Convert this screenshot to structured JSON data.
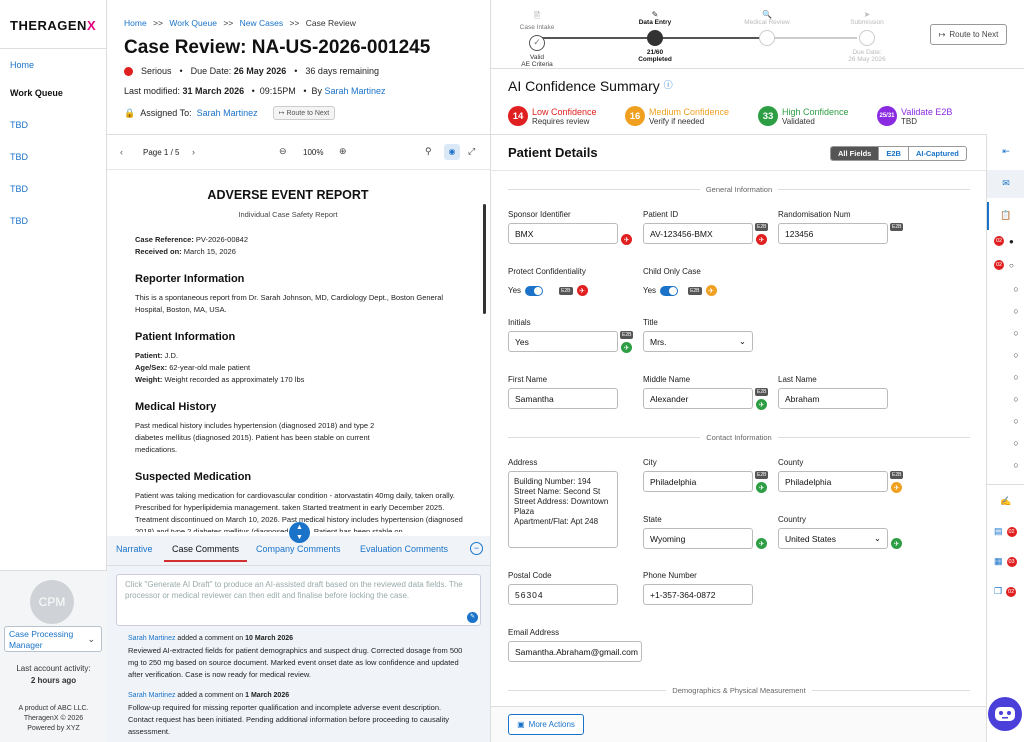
{
  "brand": {
    "name": "THERAGEN",
    "x": "X"
  },
  "sidebar": {
    "items": [
      "Home",
      "Work Queue",
      "TBD",
      "TBD",
      "TBD",
      "TBD"
    ],
    "avatar": "CPM",
    "role": "Case Processing Manager",
    "last_activity_label": "Last account activity:",
    "last_activity": "2 hours ago",
    "footer1": "A product of ABC LLC.",
    "footer2": "TheragenX © 2026",
    "footer3": "Powered by XYZ"
  },
  "breadcrumb": {
    "home": "Home",
    "sep": ">>",
    "queue": "Work Queue",
    "new": "New Cases",
    "current": "Case Review"
  },
  "case": {
    "title": "Case Review: NA-US-2026-001245",
    "severity": "Serious",
    "due_label": "Due Date:",
    "due": "26 May 2026",
    "remaining": "36 days remaining",
    "modified_label": "Last modified:",
    "modified_date": "31 March 2026",
    "modified_time": "09:15PM",
    "by_label": "By",
    "by": "Sarah Martinez",
    "assigned_label": "Assigned To:",
    "assigned": "Sarah Martinez",
    "route_small": "Route to Next"
  },
  "stepper": {
    "steps": [
      {
        "name": "Case Intake",
        "status": "Valid",
        "status2": "AE Criteria"
      },
      {
        "name": "Data Entry",
        "status": "21/60",
        "status2": "Completed"
      },
      {
        "name": "Medical Review",
        "status": "",
        "status2": ""
      },
      {
        "name": "Submission",
        "status": "Due Date:",
        "status2": "26 May 2026"
      }
    ],
    "route": "Route to Next"
  },
  "ai": {
    "title": "AI Confidence Summary",
    "items": [
      {
        "count": "14",
        "label": "Low Confidence",
        "sub": "Requires review",
        "color": "#e02020"
      },
      {
        "count": "16",
        "label": "Medium Confidence",
        "sub": "Verify if needed",
        "color": "#f0a020"
      },
      {
        "count": "33",
        "label": "High Confidence",
        "sub": "Validated",
        "color": "#2e9e44"
      },
      {
        "count": "25/31",
        "label": "Validate E2B",
        "sub": "TBD",
        "color": "#8a2be2"
      }
    ]
  },
  "viewer": {
    "page": "Page 1 / 5",
    "zoom": "100%"
  },
  "doc": {
    "title": "ADVERSE EVENT REPORT",
    "subtitle": "Individual Case Safety Report",
    "ref_label": "Case Reference:",
    "ref": "PV-2026-00842",
    "recv_label": "Received on:",
    "recv": "March 15, 2026",
    "h_reporter": "Reporter Information",
    "reporter": "This is a spontaneous report from Dr. Sarah Johnson, MD, Cardiology Dept., Boston General Hospital, Boston, MA, USA.",
    "h_patient": "Patient Information",
    "p_label": "Patient:",
    "p": "J.D.",
    "age_label": "Age/Sex:",
    "age": "62-year-old male patient",
    "w_label": "Weight:",
    "w": "Weight recorded as approximately 170 lbs",
    "h_history": "Medical History",
    "history": "Past medical history includes hypertension (diagnosed 2018) and type 2 diabetes mellitus (diagnosed 2015). Patient has been stable on current medications.",
    "h_med": "Suspected Medication",
    "med": "Patient was taking medication for cardiovascular condition - atorvastatin 40mg daily, taken orally. Prescribed for hyperlipidemia management. taken Started treatment in early December 2025. Treatment discontinued on March 10, 2026. Past medical history includes hypertension (diagnosed 2018) and type 2 diabetes mellitus (diagnosed 2015). Patient has been stable on"
  },
  "tabs": [
    "Narrative",
    "Case Comments",
    "Company Comments",
    "Evaluation Comments"
  ],
  "comments": {
    "placeholder": "Click \"Generate AI Draft\" to produce an AI-assisted draft based on the reviewed data fields. The processor or medical reviewer can then edit and finalise before locking the case.",
    "list": [
      {
        "who": "Sarah Martinez",
        "action": "added a comment on",
        "date": "10 March 2026",
        "text": "Reviewed AI-extracted fields for patient demographics and suspect drug. Corrected dosage from 500 mg to 250 mg based on source document. Marked event onset date as low confidence and updated after verification. Case is now ready for medical review."
      },
      {
        "who": "Sarah Martinez",
        "action": "added a comment on",
        "date": "1 March 2026",
        "text": "Follow-up required for missing reporter qualification and incomplete adverse event description. Contact request has been initiated. Pending additional information before proceeding to causality assessment."
      }
    ]
  },
  "patient": {
    "title": "Patient Details",
    "filters": [
      "All Fields",
      "E2B",
      "AI-Captured"
    ],
    "sec_general": "General Information",
    "sec_contact": "Contact Information",
    "sec_demo": "Demographics & Physical Measurement",
    "sponsor_label": "Sponsor Identifier",
    "sponsor": "BMX",
    "pid_label": "Patient ID",
    "pid": "AV-123456-BMX",
    "rand_label": "Randomisation Num",
    "rand": "123456",
    "protect_label": "Protect Confidentiality",
    "protect": "Yes",
    "child_label": "Child Only Case",
    "child": "Yes",
    "initials_label": "Initials",
    "initials": "Yes",
    "title_label": "Title",
    "title_val": "Mrs.",
    "first_label": "First Name",
    "first": "Samantha",
    "middle_label": "Middle Name",
    "middle": "Alexander",
    "last_label": "Last Name",
    "last": "Abraham",
    "address_label": "Address",
    "address": [
      "Building Number: 194",
      "Street Name: Second St",
      "Street Address: Downtown Plaza",
      "Apartment/Flat: Apt 248"
    ],
    "city_label": "City",
    "city": "Philadelphia",
    "county_label": "County",
    "county": "Philadelphia",
    "state_label": "State",
    "state": "Wyoming",
    "country_label": "Country",
    "country": "United States",
    "postal_label": "Postal Code",
    "postal": "56304",
    "phone_label": "Phone Number",
    "phone": "+1-357-364-0872",
    "email_label": "Email Address",
    "email": "Samantha.Abraham@gmail.com",
    "e2b": "E2B",
    "more": "More Actions"
  },
  "rail": {
    "badges": [
      "02",
      "02",
      "02",
      "03",
      "02"
    ]
  }
}
